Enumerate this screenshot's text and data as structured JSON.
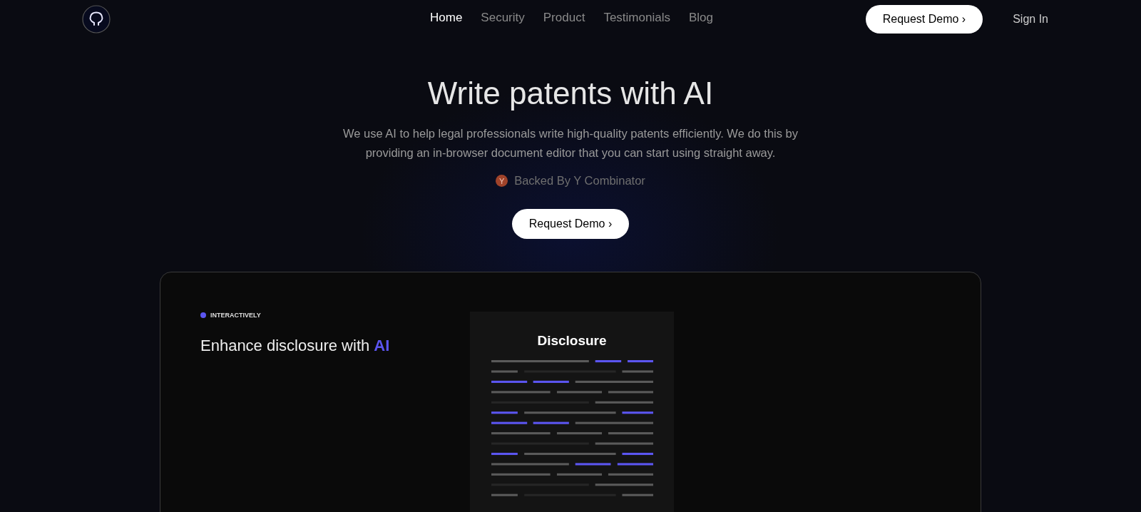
{
  "nav": {
    "links": [
      {
        "label": "Home",
        "selected": true
      },
      {
        "label": "Security",
        "selected": false
      },
      {
        "label": "Product",
        "selected": false
      },
      {
        "label": "Testimonials",
        "selected": false
      },
      {
        "label": "Blog",
        "selected": false
      }
    ],
    "cta": "Request Demo",
    "cta_caret": "›",
    "sign_in": "Sign In"
  },
  "hero": {
    "title": "Write patents with AI",
    "subtitle": "We use AI to help legal professionals write high-quality patents efficiently. We do this by providing an in-browser document editor that you can start using straight away.",
    "badge_letter": "Y",
    "backed_by": "Backed By Y Combinator",
    "cta": "Request Demo",
    "cta_caret": "›"
  },
  "showcase": {
    "tag": "INTERACTIVELY",
    "headline": "Enhance disclosure with",
    "highlight": "AI",
    "document_title": "Disclosure"
  }
}
